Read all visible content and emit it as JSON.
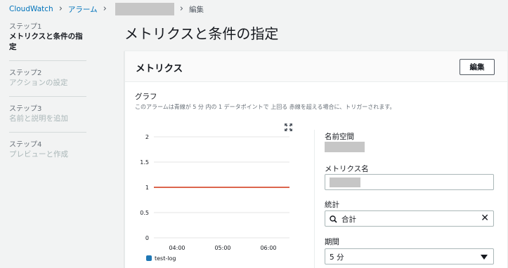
{
  "breadcrumb": {
    "root": "CloudWatch",
    "alarms": "アラーム",
    "current": "編集"
  },
  "sidebar": {
    "steps": [
      {
        "num": "ステップ1",
        "title": "メトリクスと条件の指定"
      },
      {
        "num": "ステップ2",
        "title": "アクションの設定"
      },
      {
        "num": "ステップ3",
        "title": "名前と説明を追加"
      },
      {
        "num": "ステップ4",
        "title": "プレビューと作成"
      }
    ]
  },
  "page": {
    "title": "メトリクスと条件の指定"
  },
  "panel": {
    "title": "メトリクス",
    "edit_label": "編集",
    "graph_title": "グラフ",
    "graph_desc": "このアラームは青線が 5 分 内の 1 データポイントで 上回る 赤線を超える場合に、トリガーされます。"
  },
  "fields": {
    "namespace_label": "名前空間",
    "metric_name_label": "メトリクス名",
    "statistic_label": "統計",
    "statistic_value": "合計",
    "period_label": "期間",
    "period_value": "5 分"
  },
  "colors": {
    "threshold": "#d13212",
    "series": "#1f77b4",
    "link": "#0073bb"
  },
  "chart_data": {
    "type": "line",
    "yticks": [
      "2",
      "1.5",
      "1",
      "0.5",
      "0"
    ],
    "xticks": [
      "04:00",
      "05:00",
      "06:00"
    ],
    "ylim": [
      0,
      2
    ],
    "threshold": 1,
    "legend": "test-log",
    "series": []
  }
}
